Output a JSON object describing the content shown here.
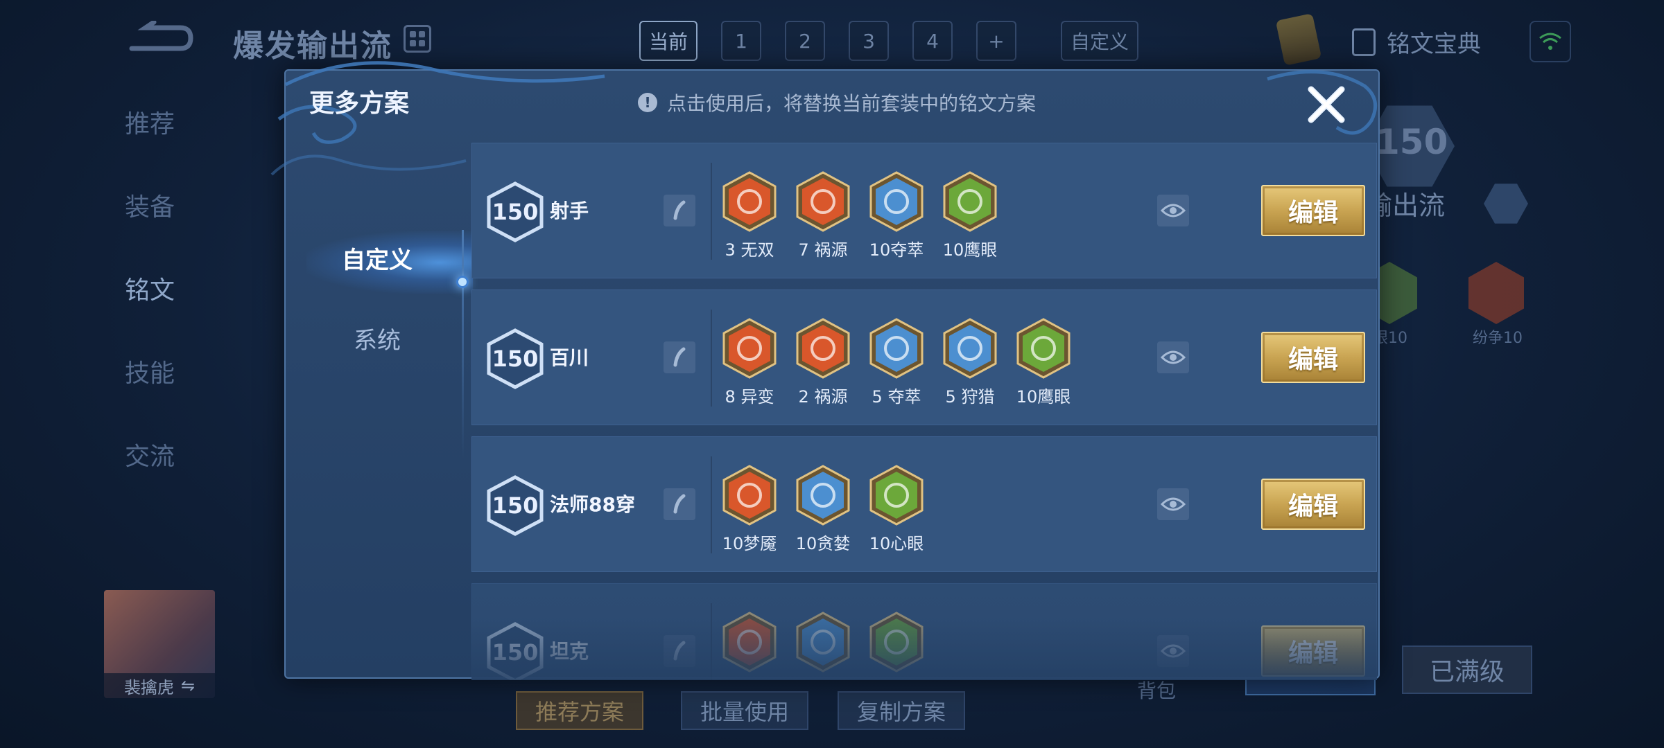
{
  "background": {
    "title": "爆发输出流",
    "tabs": [
      "当前",
      "1",
      "2",
      "3",
      "4",
      "+"
    ],
    "custom_tab": "自定义",
    "codex": "铭文宝典",
    "sidebar": [
      "推荐",
      "装备",
      "铭文",
      "技能",
      "交流"
    ],
    "hero_name": "裴擒虎",
    "build_level": "150",
    "build_name": "输出流",
    "rune_labels": [
      "眼10",
      "纷争10"
    ],
    "bottom_buttons": [
      "推荐方案",
      "批量使用",
      "复制方案"
    ],
    "bag": "背包",
    "maxed": "已满级"
  },
  "modal": {
    "title": "更多方案",
    "hint": "点击使用后，将替换当前套装中的铭文方案",
    "nav": [
      "自定义",
      "系统"
    ],
    "edit_label": "编辑",
    "rows": [
      {
        "level": "150",
        "name": "射手",
        "runes": [
          {
            "label": "3 无双",
            "icon": "red-rune-wushuang",
            "color": "#d9572b"
          },
          {
            "label": "7 祸源",
            "icon": "red-rune-huoyuan",
            "color": "#d9572b"
          },
          {
            "label": "10夺萃",
            "icon": "blue-rune-duocui",
            "color": "#4c8fd0"
          },
          {
            "label": "10鹰眼",
            "icon": "green-rune-yingyan",
            "color": "#6ca83a"
          }
        ]
      },
      {
        "level": "150",
        "name": "百川",
        "runes": [
          {
            "label": "8 异变",
            "icon": "red-rune-yibian",
            "color": "#d9572b"
          },
          {
            "label": "2 祸源",
            "icon": "red-rune-huoyuan",
            "color": "#d9572b"
          },
          {
            "label": "5 夺萃",
            "icon": "blue-rune-duocui",
            "color": "#4c8fd0"
          },
          {
            "label": "5 狩猎",
            "icon": "blue-rune-shoulie",
            "color": "#4c8fd0"
          },
          {
            "label": "10鹰眼",
            "icon": "green-rune-yingyan",
            "color": "#6ca83a"
          }
        ]
      },
      {
        "level": "150",
        "name": "法师88穿",
        "runes": [
          {
            "label": "10梦魇",
            "icon": "red-rune-mengyan",
            "color": "#d9572b"
          },
          {
            "label": "10贪婪",
            "icon": "blue-rune-tanlan",
            "color": "#4c8fd0"
          },
          {
            "label": "10心眼",
            "icon": "green-rune-xinyan",
            "color": "#6ca83a"
          }
        ]
      },
      {
        "level": "150",
        "name": "坦克",
        "runes": [
          {
            "label": "",
            "icon": "red-rune",
            "color": "#d9572b"
          },
          {
            "label": "",
            "icon": "blue-rune",
            "color": "#4c8fd0"
          },
          {
            "label": "",
            "icon": "green-rune",
            "color": "#6ca83a"
          }
        ]
      }
    ]
  }
}
